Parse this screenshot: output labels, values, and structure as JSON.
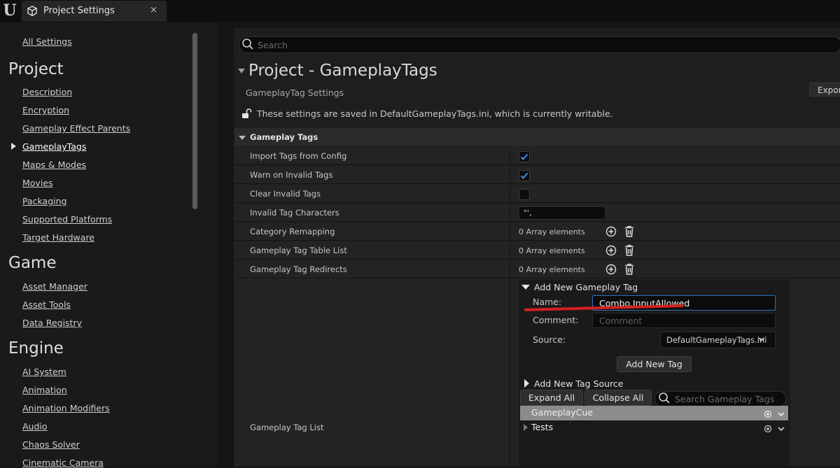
{
  "titlebar": {
    "tab_label": "Project Settings",
    "close_glyph": "×",
    "logo_glyph": "U",
    "logo_icon": "unreal-logo-icon",
    "tab_icon": "settings-cube-icon"
  },
  "sidebar": {
    "all_settings": "All Settings",
    "project": {
      "title": "Project",
      "items": [
        "Description",
        "Encryption",
        "Gameplay Effect Parents",
        "GameplayTags",
        "Maps & Modes",
        "Movies",
        "Packaging",
        "Supported Platforms",
        "Target Hardware"
      ]
    },
    "game": {
      "title": "Game",
      "items": [
        "Asset Manager",
        "Asset Tools",
        "Data Registry"
      ]
    },
    "engine": {
      "title": "Engine",
      "items": [
        "AI System",
        "Animation",
        "Animation Modifiers",
        "Audio",
        "Chaos Solver",
        "Cinematic Camera"
      ]
    },
    "selected_item": "GameplayTags"
  },
  "search": {
    "placeholder": "Search"
  },
  "header": {
    "title": "Project - GameplayTags",
    "subtitle": "GameplayTag Settings",
    "export_label": "Export",
    "saved_note": "These settings are saved in DefaultGameplayTags.ini, which is currently writable."
  },
  "category": {
    "label": "Gameplay Tags"
  },
  "props": {
    "import_tags": {
      "label": "Import Tags from Config",
      "checked": true
    },
    "warn_invalid": {
      "label": "Warn on Invalid Tags",
      "checked": true
    },
    "clear_invalid": {
      "label": "Clear Invalid Tags",
      "checked": false
    },
    "invalid_chars": {
      "label": "Invalid Tag Characters",
      "value": "\"',"
    },
    "category_remap": {
      "label": "Category Remapping",
      "value": "0 Array elements"
    },
    "table_list": {
      "label": "Gameplay Tag Table List",
      "value": "0 Array elements"
    },
    "redirects": {
      "label": "Gameplay Tag Redirects",
      "value": "0 Array elements"
    },
    "tag_list": {
      "label": "Gameplay Tag List"
    }
  },
  "add_tag": {
    "title": "Add New Gameplay Tag",
    "name_label": "Name:",
    "name_value": "Combo.InputAllowed",
    "comment_label": "Comment:",
    "comment_placeholder": "Comment",
    "source_label": "Source:",
    "source_value": "DefaultGameplayTags.ini",
    "add_button": "Add New Tag"
  },
  "add_source": {
    "title": "Add New Tag Source"
  },
  "toolbar": {
    "expand_all": "Expand All",
    "collapse_all": "Collapse All",
    "search_placeholder": "Search Gameplay Tags"
  },
  "tags": [
    {
      "name": "GameplayCue",
      "highlighted": true
    },
    {
      "name": "Tests",
      "highlighted": false
    }
  ],
  "colors": {
    "accent": "#2f6fb8",
    "annotation": "#d42020",
    "check": "#3d8ef0"
  }
}
